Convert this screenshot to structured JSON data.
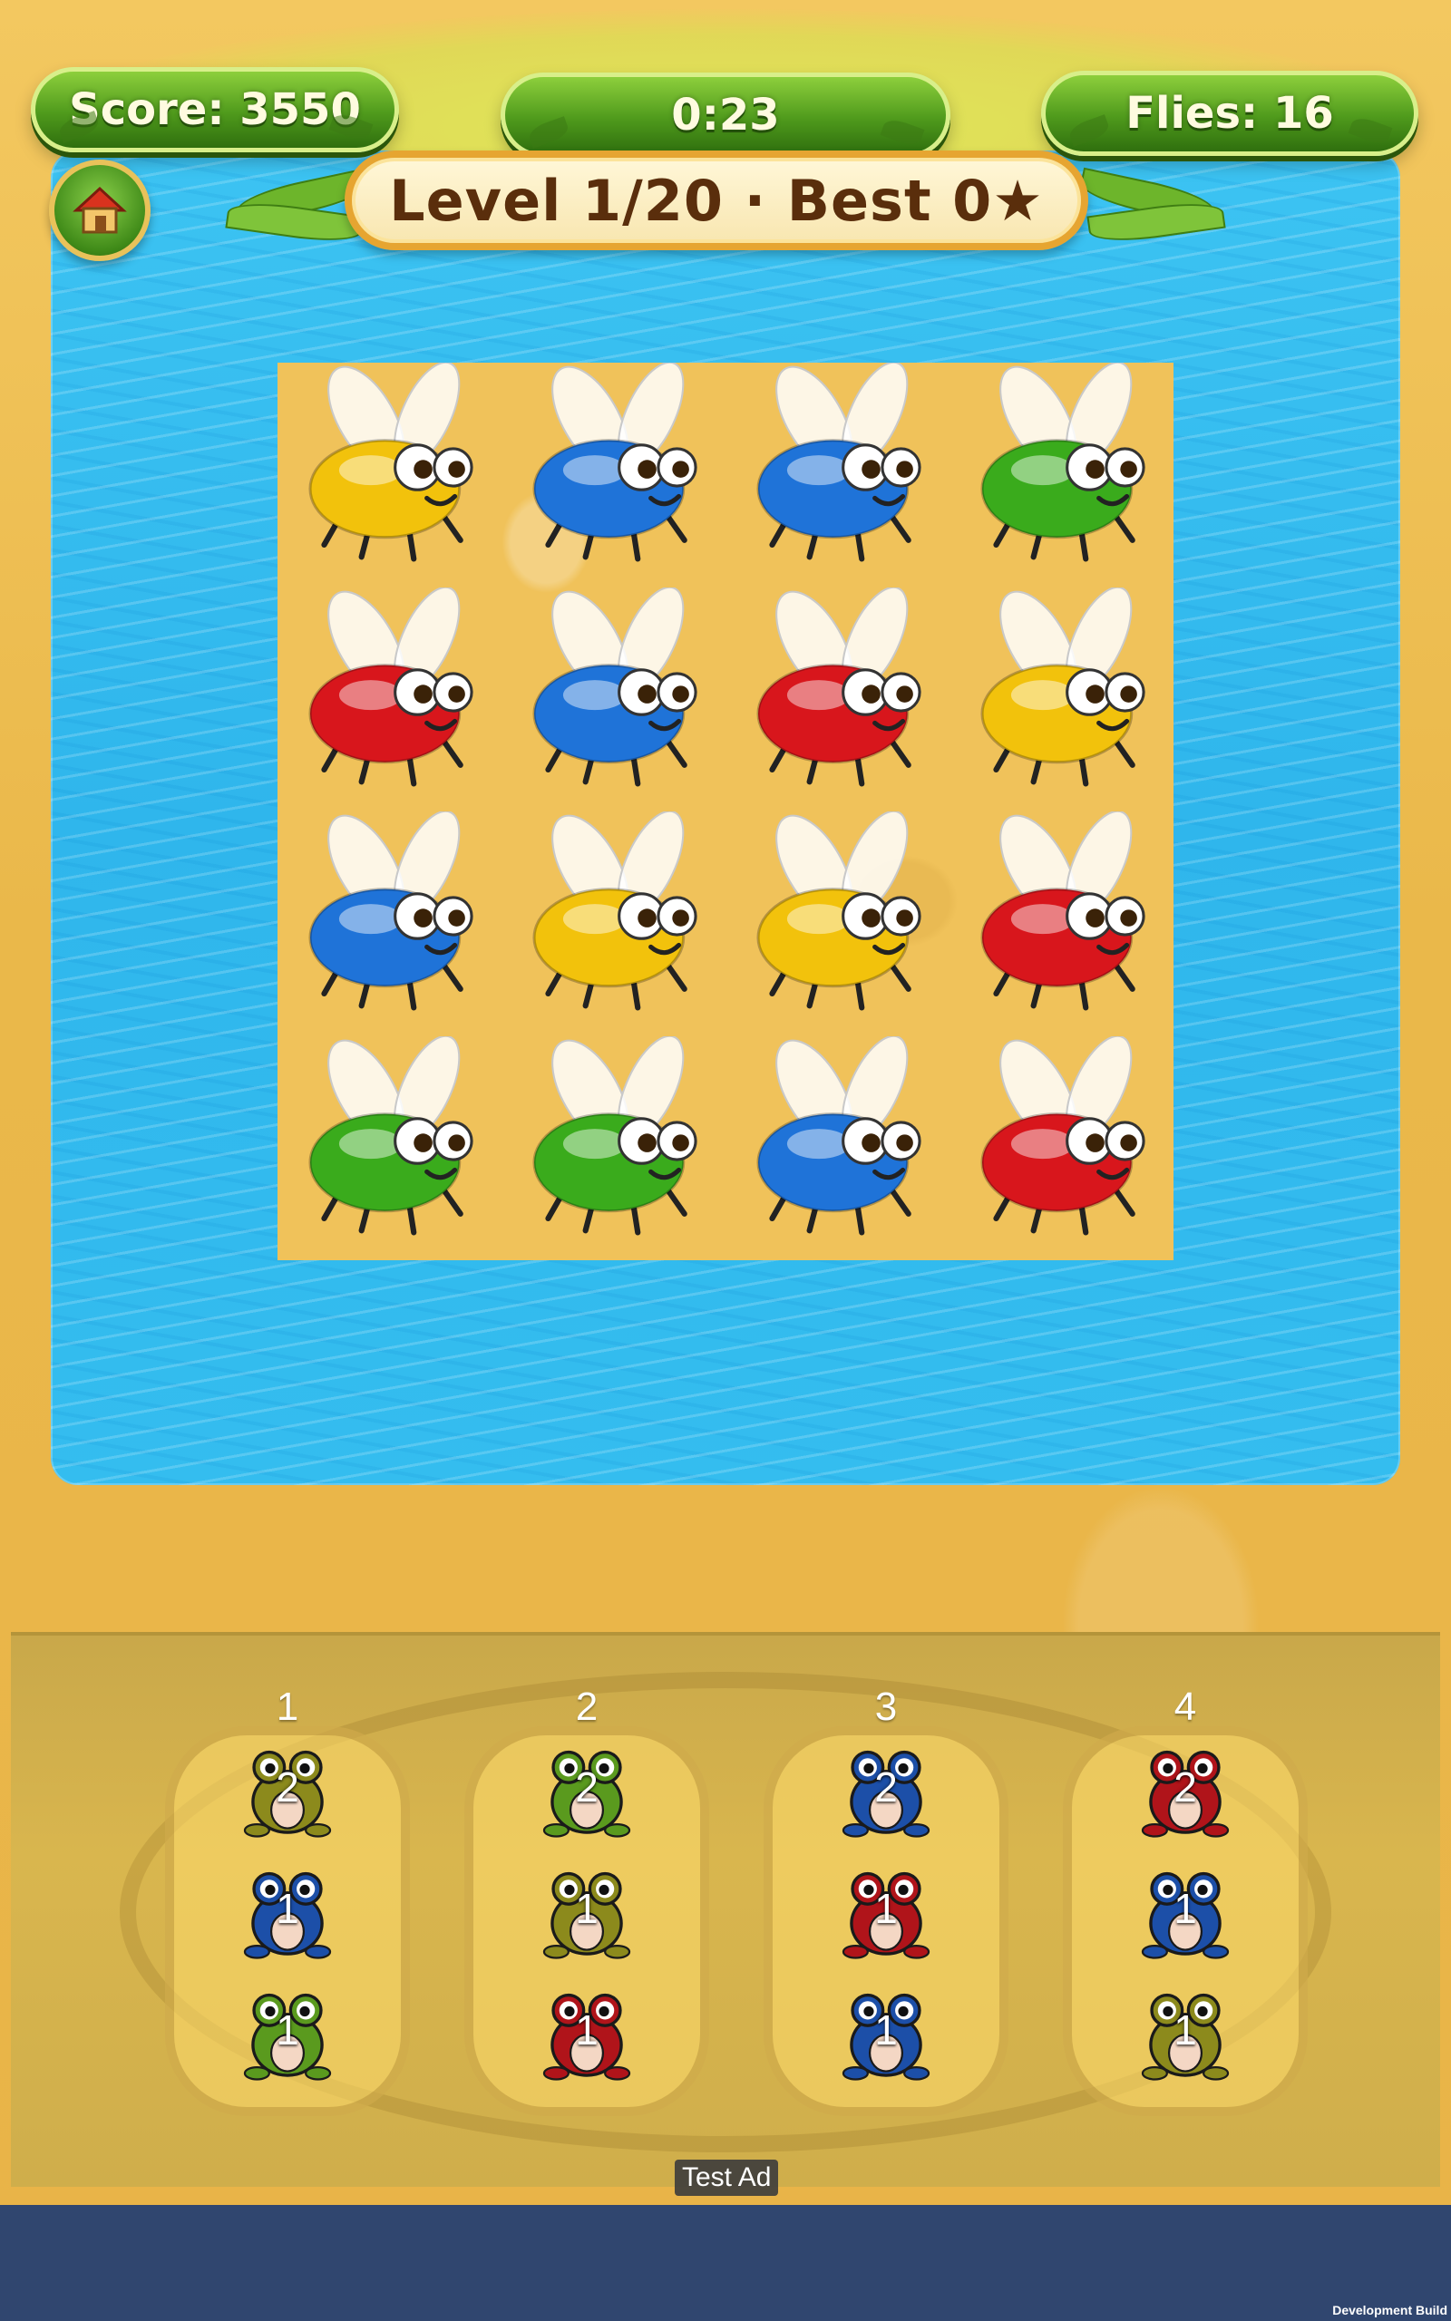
{
  "hud": {
    "score": "Score: 3550",
    "timer": "0:23",
    "flies": "Flies: 16"
  },
  "level_banner": "Level 1/20 · Best 0★",
  "home_icon": "home-icon",
  "board": {
    "rows": 4,
    "cols": 4,
    "flies": [
      [
        "yellow",
        "blue",
        "blue",
        "green"
      ],
      [
        "red",
        "blue",
        "red",
        "yellow"
      ],
      [
        "blue",
        "yellow",
        "yellow",
        "red"
      ],
      [
        "green",
        "green",
        "blue",
        "red"
      ]
    ]
  },
  "colors": {
    "yellow": "#f2c20c",
    "blue": "#1f73d8",
    "green": "#3aab1c",
    "red": "#d8161c",
    "olive": "#8c8a1c",
    "frog_green": "#5a9a1e",
    "frog_blue": "#1c4fa8",
    "frog_red": "#b0141a"
  },
  "slots": [
    {
      "label": "1",
      "frogs": [
        {
          "color": "olive",
          "count": "2"
        },
        {
          "color": "blue",
          "count": "1"
        },
        {
          "color": "green",
          "count": "1"
        }
      ]
    },
    {
      "label": "2",
      "frogs": [
        {
          "color": "green",
          "count": "2"
        },
        {
          "color": "olive",
          "count": "1"
        },
        {
          "color": "red",
          "count": "1"
        }
      ]
    },
    {
      "label": "3",
      "frogs": [
        {
          "color": "blue",
          "count": "2"
        },
        {
          "color": "red",
          "count": "1"
        },
        {
          "color": "blue",
          "count": "1"
        }
      ]
    },
    {
      "label": "4",
      "frogs": [
        {
          "color": "red",
          "count": "2"
        },
        {
          "color": "blue",
          "count": "1"
        },
        {
          "color": "olive",
          "count": "1"
        }
      ]
    }
  ],
  "ad_label": "Test Ad",
  "dev_build": "Development Build"
}
